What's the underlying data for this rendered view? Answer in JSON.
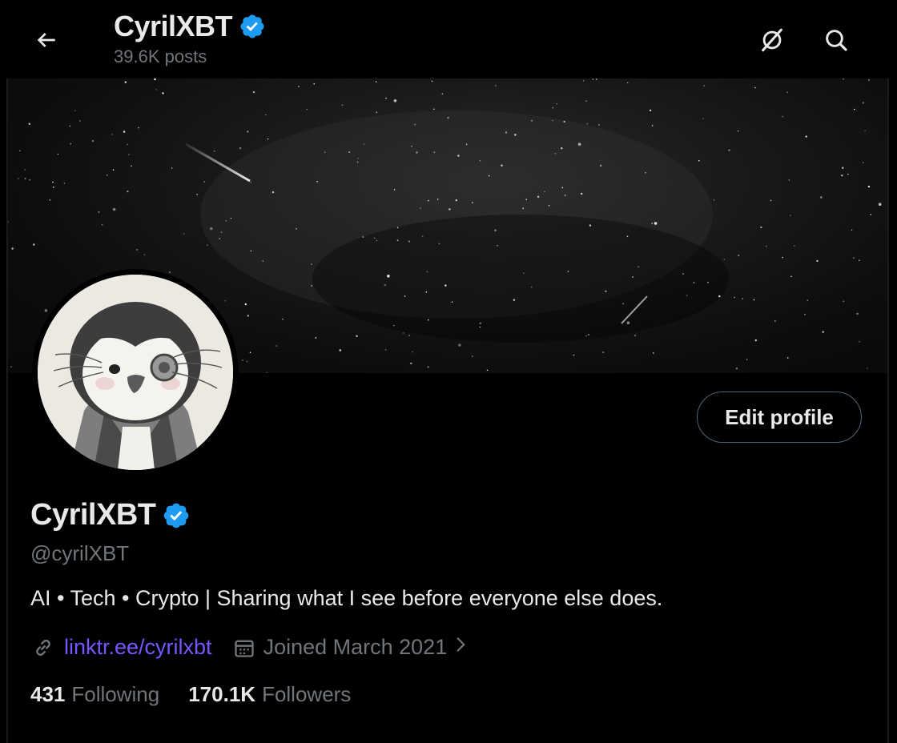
{
  "header": {
    "display_name": "CyrilXBT",
    "post_count": "39.6K posts",
    "back_icon": "arrow-left-icon",
    "grok_icon": "grok-icon",
    "search_icon": "search-icon"
  },
  "profile": {
    "display_name": "CyrilXBT",
    "handle": "@cyrilXBT",
    "bio": "AI • Tech • Crypto | Sharing what I see before everyone else does.",
    "link": "linktr.ee/cyrilxbt",
    "joined": "Joined March 2021",
    "verified": true,
    "edit_profile_label": "Edit profile",
    "following_count": "431",
    "following_label": "Following",
    "followers_count": "170.1K",
    "followers_label": "Followers"
  },
  "colors": {
    "background": "#000000",
    "verified_badge": "#1d9bf0",
    "link": "#7856ff",
    "secondary_text": "#71767b",
    "primary_text": "#e7e9ea"
  }
}
